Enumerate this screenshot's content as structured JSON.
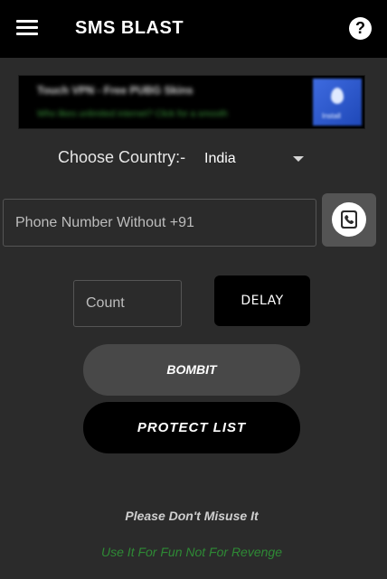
{
  "app_bar": {
    "title": "SMS BLAST",
    "menu_icon": "hamburger-menu-icon",
    "help_icon": "help-circle-icon",
    "help_glyph": "?",
    "background": "#000000"
  },
  "ad_banner": {
    "title": "Touch VPN - Free PUBG Skins",
    "subtitle": "Who likes unlimited internet? Click for a smooth",
    "cta": "Install"
  },
  "country": {
    "label": "Choose Country:-",
    "selected": "India"
  },
  "phone": {
    "placeholder": "Phone Number Without +91",
    "value": "",
    "contact_icon": "phone-book-icon"
  },
  "count": {
    "placeholder": "Count",
    "value": ""
  },
  "buttons": {
    "delay": "DELAY",
    "bombit": "BOMBIT",
    "protect_list": "PROTECT LIST"
  },
  "footer": {
    "warning": "Please Don't Misuse It",
    "fun_note": "Use It For Fun Not For Revenge",
    "fun_note_color": "#2e8a35"
  },
  "colors": {
    "background": "#2b2b2b",
    "secondary_button": "#484848",
    "primary_button": "#000000"
  }
}
